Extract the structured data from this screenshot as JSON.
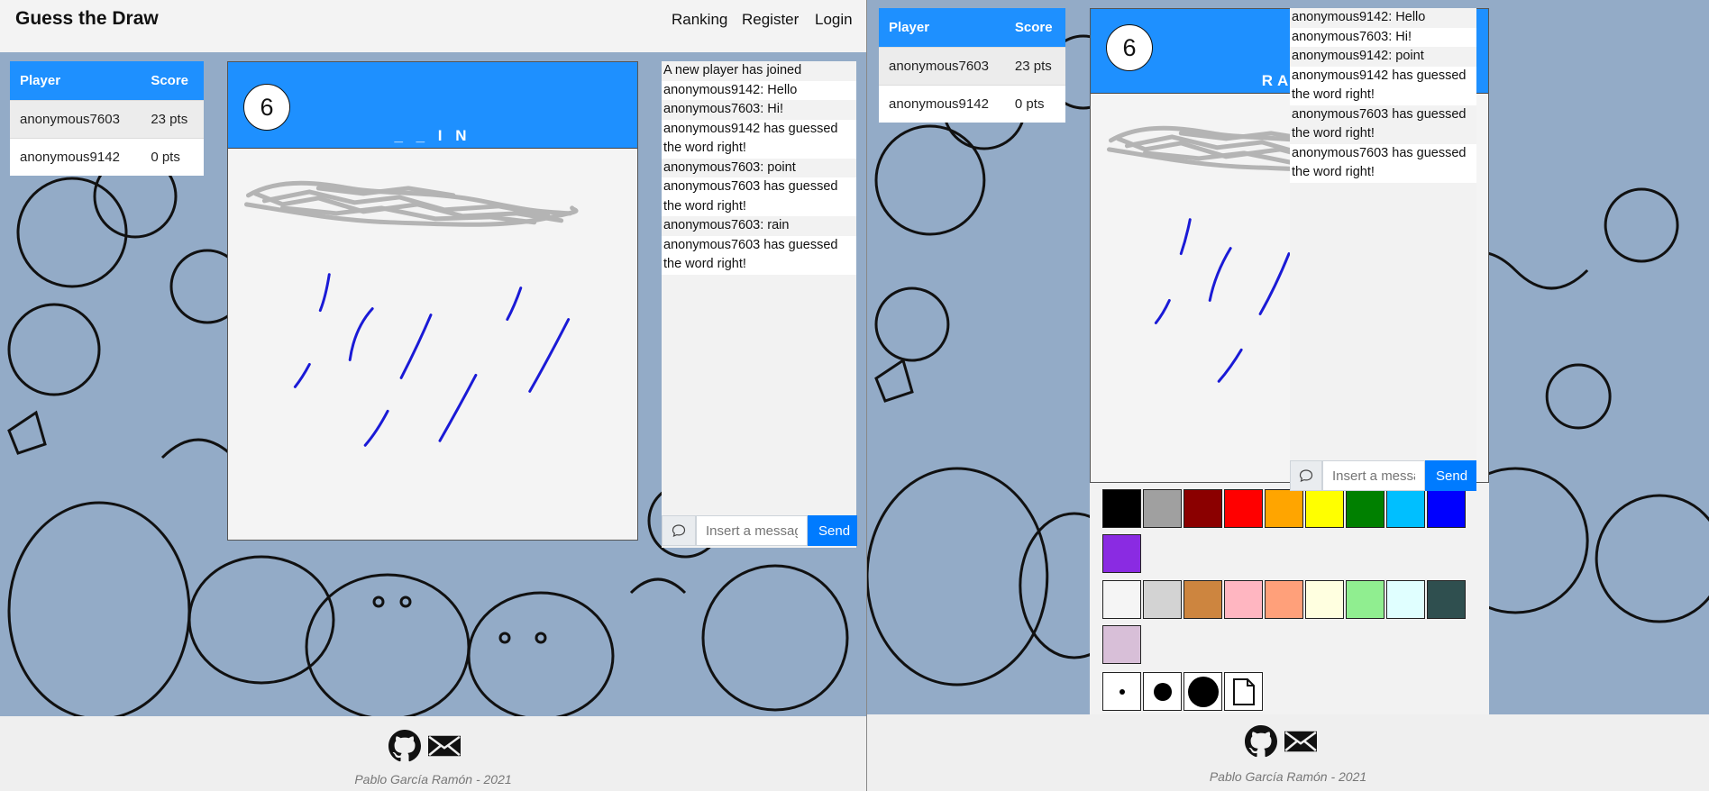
{
  "app": {
    "title": "Guess the Draw"
  },
  "nav": {
    "ranking": "Ranking",
    "register": "Register",
    "login": "Login"
  },
  "scoreboard": {
    "player_header": "Player",
    "score_header": "Score",
    "rows": [
      {
        "player": "anonymous7603",
        "score": "23 pts"
      },
      {
        "player": "anonymous9142",
        "score": "0 pts"
      }
    ]
  },
  "guesser_view": {
    "timer": "6",
    "word_hint": "_ _ I N",
    "chat": [
      "A new player has joined",
      "anonymous9142: Hello",
      "anonymous7603: Hi!",
      "anonymous9142 has guessed the word right!",
      "anonymous7603: point",
      "anonymous7603 has guessed the word right!",
      "anonymous7603: rain",
      "anonymous7603 has guessed the word right!"
    ]
  },
  "drawer_view": {
    "timer": "6",
    "word": "RAIN",
    "chat": [
      "anonymous9142: Hello",
      "anonymous7603: Hi!",
      "anonymous9142: point",
      "anonymous9142 has guessed the word right!",
      "anonymous7603 has guessed the word right!",
      "anonymous7603 has guessed the word right!"
    ],
    "palette": {
      "colors_row1": [
        "#000000",
        "#a0a0a0",
        "#8b0000",
        "#ff0000",
        "#ffa500",
        "#ffff00",
        "#008000",
        "#00bfff",
        "#0000ff",
        "#8a2be2"
      ],
      "colors_row2": [
        "#f5f5f5",
        "#d3d3d3",
        "#cd853f",
        "#ffb6c1",
        "#ffa07a",
        "#ffffe0",
        "#90ee90",
        "#e0ffff",
        "#2f4f4f",
        "#d8bfd8"
      ],
      "tools": [
        "brush-small",
        "brush-medium",
        "brush-large",
        "clear-canvas"
      ]
    }
  },
  "chat_input": {
    "placeholder": "Insert a message",
    "send_label": "Send"
  },
  "footer": {
    "credit": "Pablo García Ramón - 2021",
    "icons": [
      "github-icon",
      "mail-icon"
    ]
  },
  "colors": {
    "accent": "#1e90ff",
    "button": "#007bff",
    "background": "#93abc7",
    "stroke_blue": "#1a1ad6"
  }
}
